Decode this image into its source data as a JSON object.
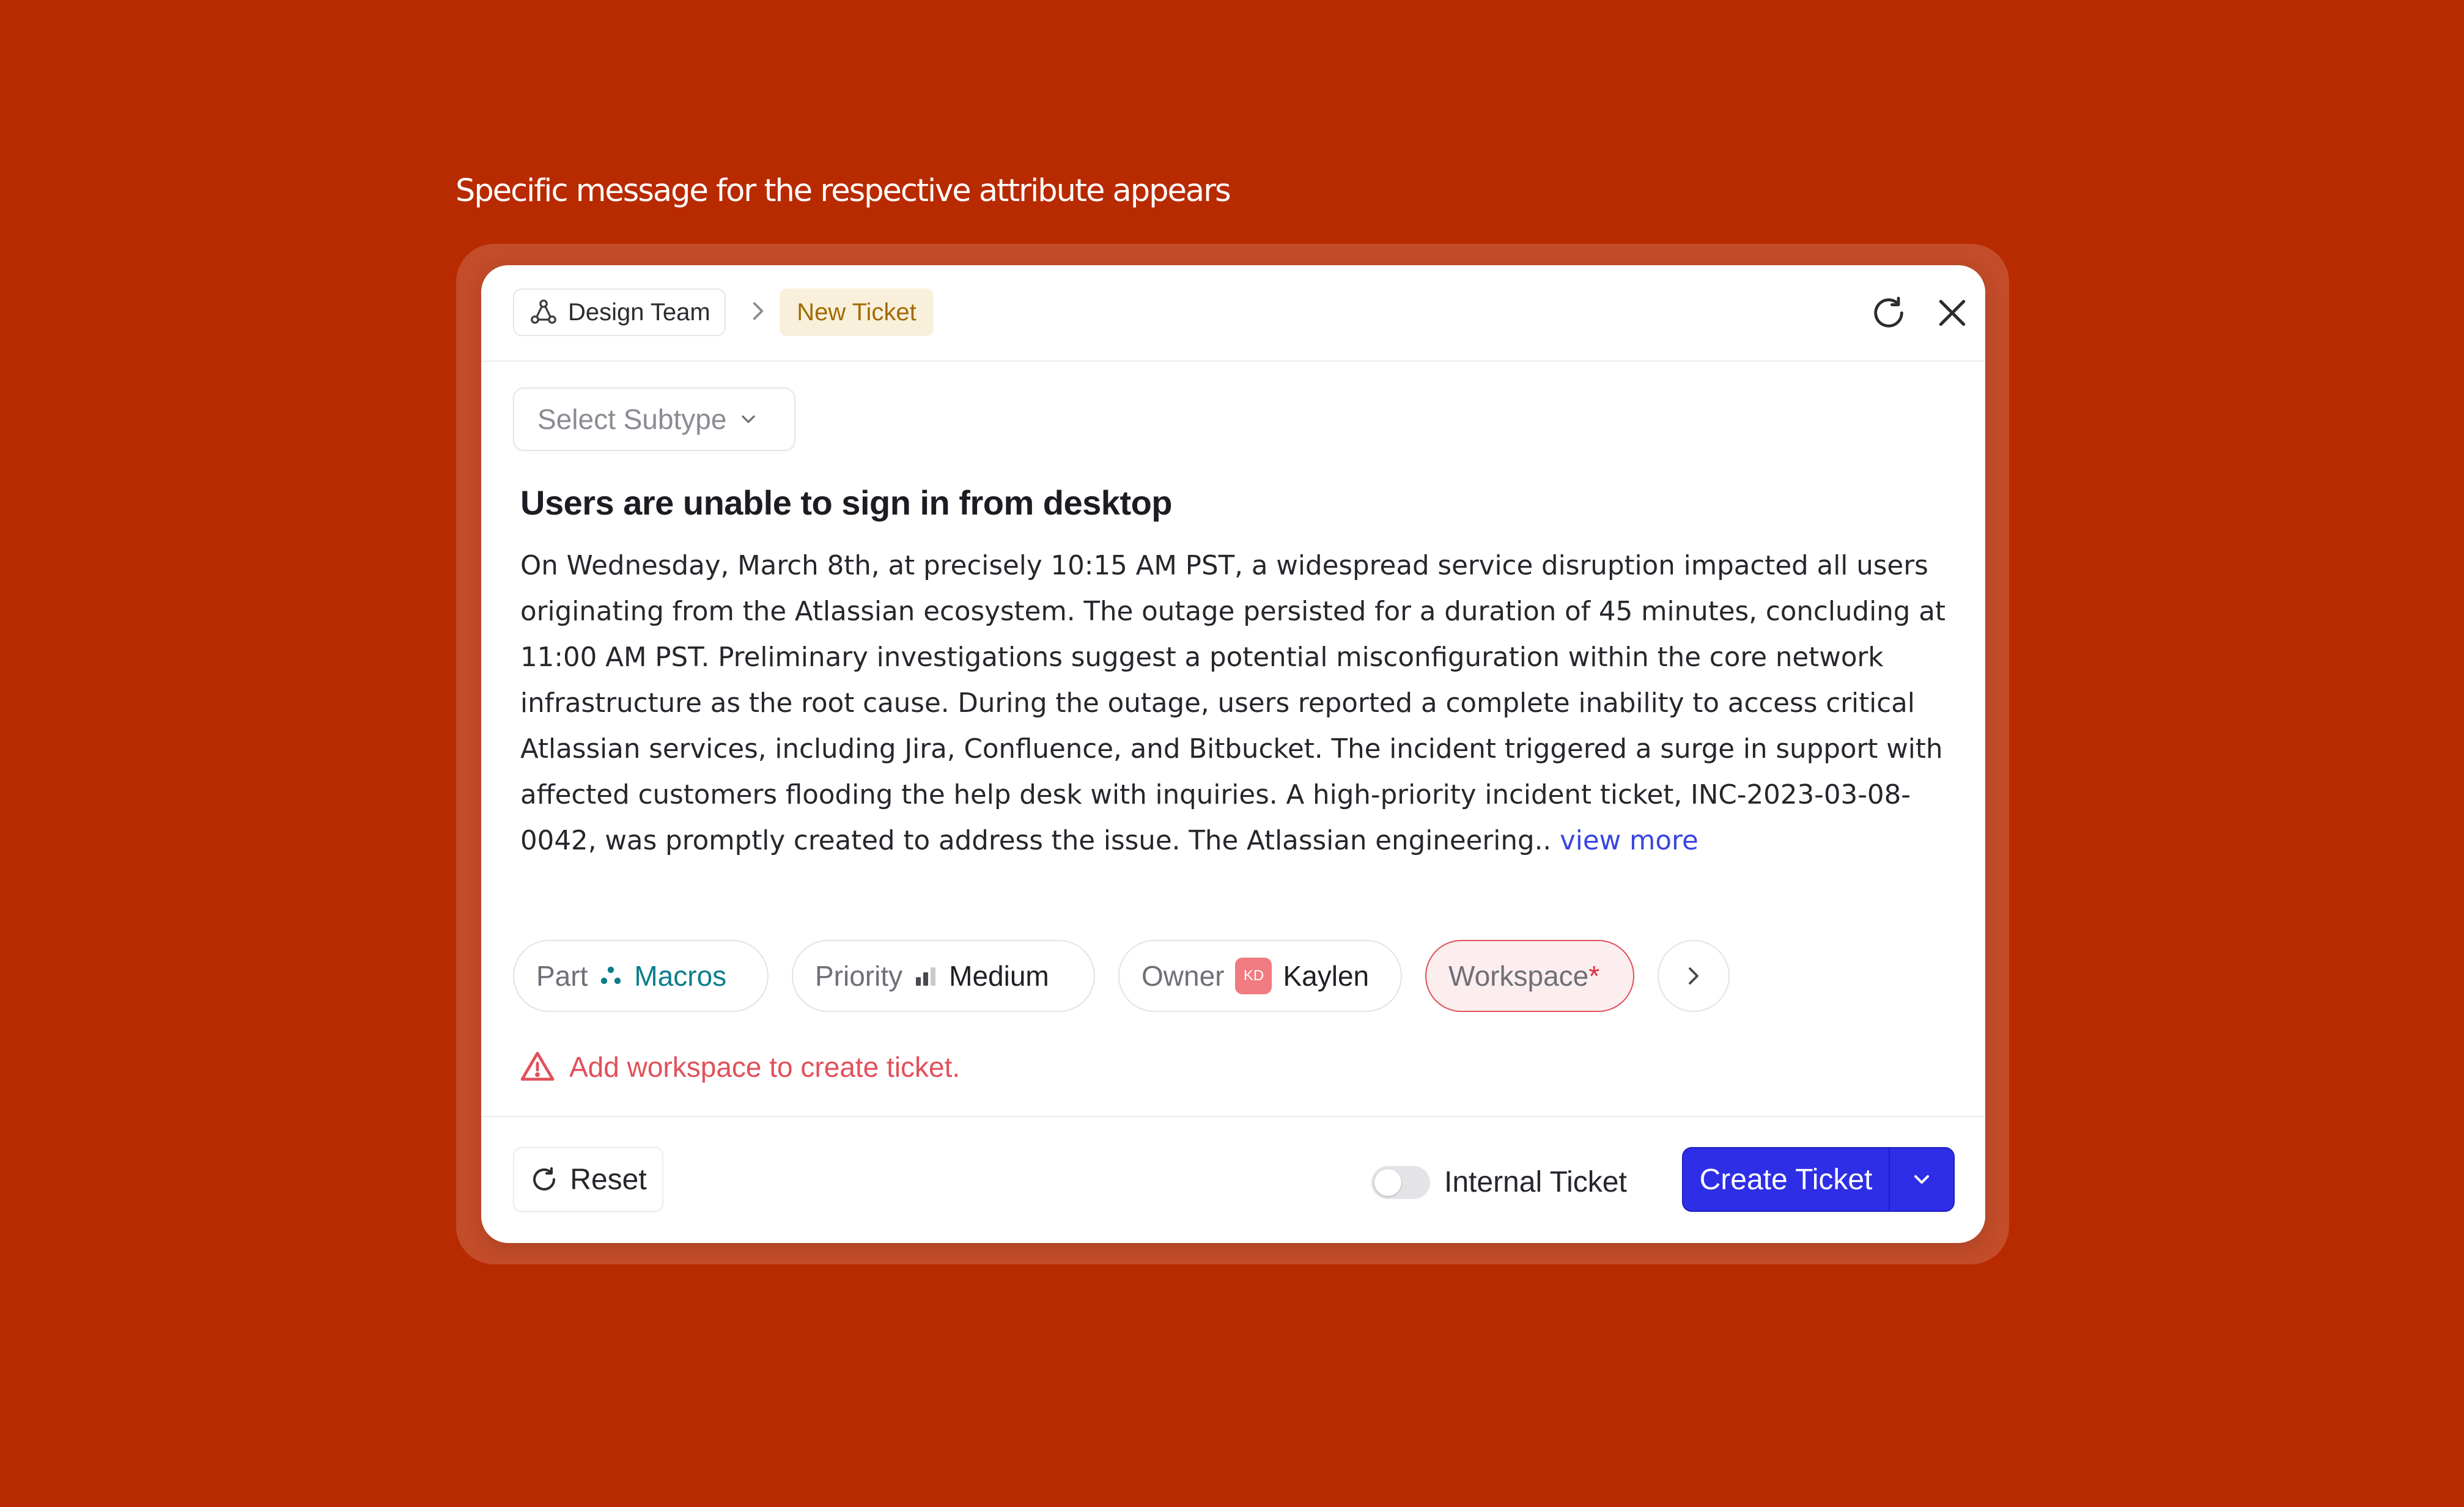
{
  "caption": "Specific message for the respective attribute appears",
  "header": {
    "team_label": "Design Team",
    "ticket_badge": "New Ticket"
  },
  "subtype": {
    "placeholder": "Select Subtype"
  },
  "ticket": {
    "title": "Users are unable to sign in from desktop",
    "description": "On Wednesday, March 8th, at precisely 10:15 AM PST, a widespread service disruption impacted all users originating from the Atlassian ecosystem. The outage persisted for a duration of 45 minutes, concluding at 11:00 AM PST. Preliminary investigations suggest a potential misconfiguration within the core network infrastructure as the root cause. During the outage, users reported a complete inability to access critical Atlassian services, including Jira, Confluence, and Bitbucket. The incident triggered a surge in support with affected customers flooding the help desk with inquiries. A high-priority incident ticket, INC-2023-03-08-0042, was promptly created to address the issue. The Atlassian engineering..",
    "view_more": "view more"
  },
  "attributes": {
    "part": {
      "label": "Part",
      "value": "Macros"
    },
    "priority": {
      "label": "Priority",
      "value": "Medium"
    },
    "owner": {
      "label": "Owner",
      "avatar_initials": "KD",
      "value": "Kaylen"
    },
    "workspace": {
      "label": "Workspace",
      "required_mark": "*"
    }
  },
  "error_message": "Add workspace to create ticket.",
  "footer": {
    "reset_label": "Reset",
    "internal_label": "Internal Ticket",
    "internal_enabled": false,
    "create_label": "Create Ticket"
  },
  "colors": {
    "background": "#B82A00",
    "primary": "#2D2EE6",
    "error": "#E2505A",
    "badge_text": "#A16B00",
    "teal": "#0C7E8C"
  }
}
